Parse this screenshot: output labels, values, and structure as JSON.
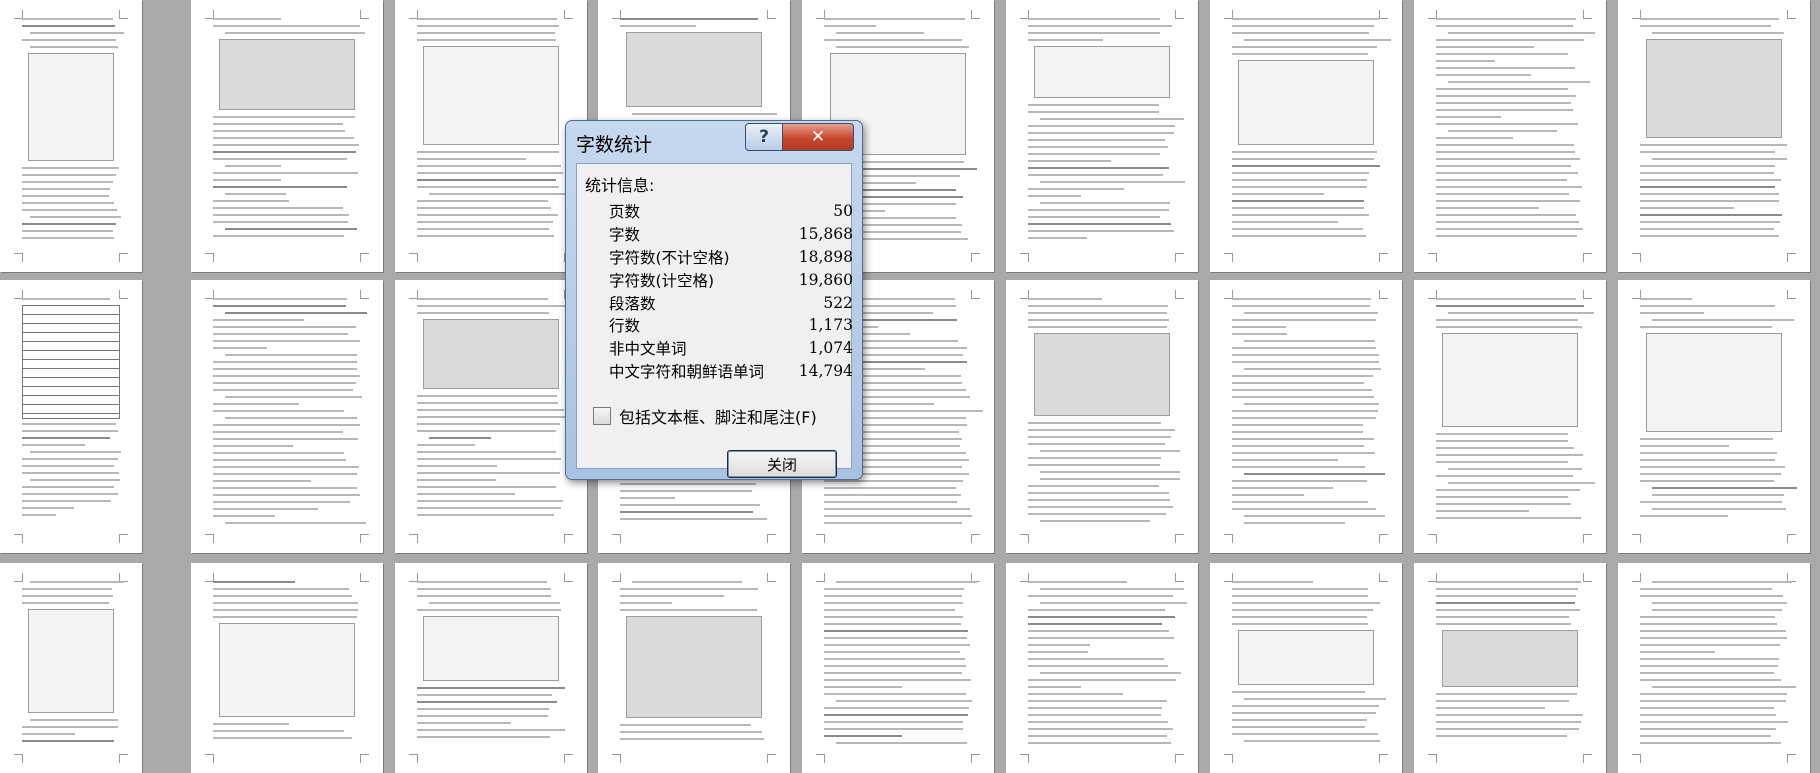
{
  "dialog": {
    "title": "字数统计",
    "help_glyph": "?",
    "close_glyph": "✕",
    "stats_heading": "统计信息:",
    "stats": [
      {
        "label": "页数",
        "value": "50"
      },
      {
        "label": "字数",
        "value": "15,868"
      },
      {
        "label": "字符数(不计空格)",
        "value": "18,898"
      },
      {
        "label": "字符数(计空格)",
        "value": "19,860"
      },
      {
        "label": "段落数",
        "value": "522"
      },
      {
        "label": "行数",
        "value": "1,173"
      },
      {
        "label": "非中文单词",
        "value": "1,074"
      },
      {
        "label": "中文字符和朝鲜语单词",
        "value": "14,794"
      }
    ],
    "include_textboxes_label": "包括文本框、脚注和尾注(F)",
    "include_textboxes_checked": false,
    "close_button_label": "关闭"
  },
  "document_view": {
    "mode": "multi-page thumbnails",
    "rows": 3,
    "columns": 9
  }
}
